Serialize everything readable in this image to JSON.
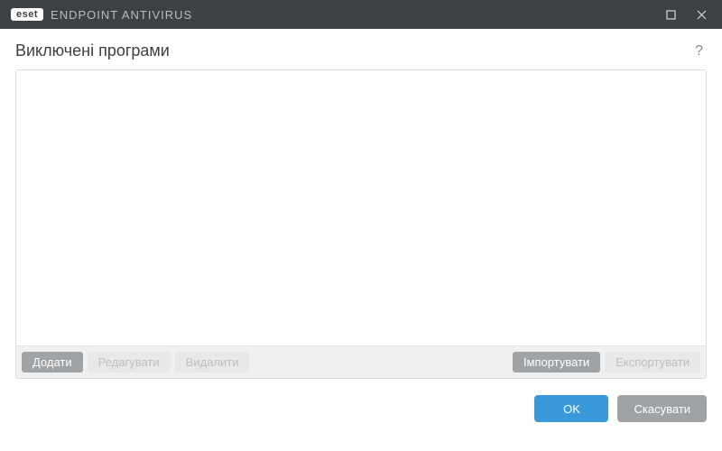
{
  "titlebar": {
    "brand_badge": "eset",
    "brand_text": "ENDPOINT ANTIVIRUS"
  },
  "page": {
    "title": "Виключені програми"
  },
  "toolbar": {
    "add": "Додати",
    "edit": "Редагувати",
    "delete": "Видалити",
    "import": "Імпортувати",
    "export": "Експортувати"
  },
  "footer": {
    "ok": "OK",
    "cancel": "Скасувати"
  },
  "help_glyph": "?"
}
